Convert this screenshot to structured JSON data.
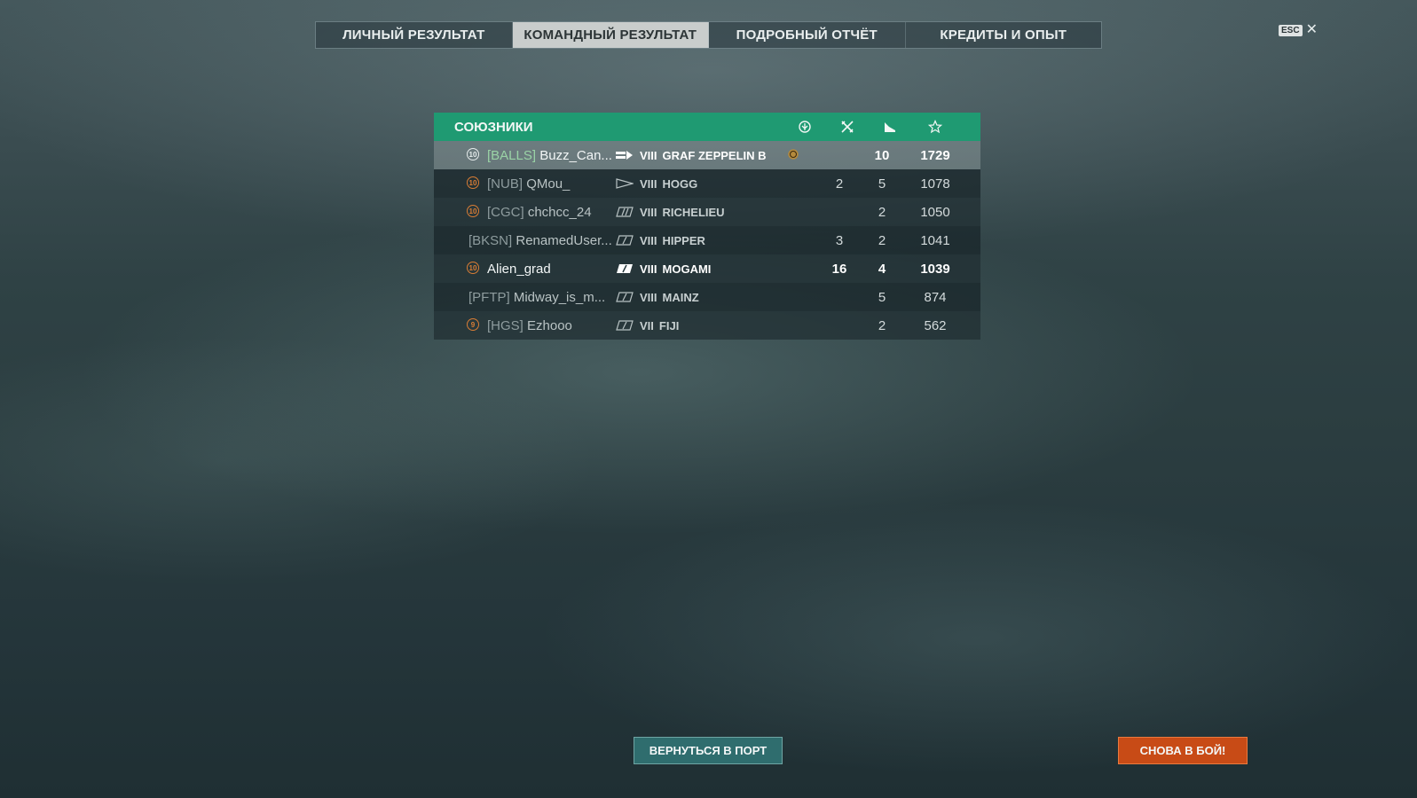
{
  "tabs": [
    {
      "label": "ЛИЧНЫЙ РЕЗУЛЬТАТ",
      "active": false
    },
    {
      "label": "КОМАНДНЫЙ РЕЗУЛЬТАТ",
      "active": true
    },
    {
      "label": "ПОДРОБНЫЙ ОТЧЁТ",
      "active": false
    },
    {
      "label": "КРЕДИТЫ И ОПЫТ",
      "active": false
    }
  ],
  "close": {
    "key": "ESC",
    "icon": "close-icon"
  },
  "team": {
    "title": "СОЮЗНИКИ",
    "columns": [
      {
        "icon": "commander-medal-icon"
      },
      {
        "icon": "crossed-planes-icon"
      },
      {
        "icon": "ship-kill-icon"
      },
      {
        "icon": "star-icon"
      }
    ],
    "rows": [
      {
        "level": "10",
        "clan": "[BALLS]",
        "name": "Buzz_Can...",
        "ship_type": "carrier",
        "tier": "VIII",
        "ship": "GRAF ZEPPELIN B",
        "medal": true,
        "planes": "",
        "kills": "10",
        "exp": "1729",
        "self": true
      },
      {
        "level": "10",
        "clan": "[NUB]",
        "name": "QMou_",
        "ship_type": "destroyer",
        "tier": "VIII",
        "ship": "HOGG",
        "medal": false,
        "planes": "2",
        "kills": "5",
        "exp": "1078"
      },
      {
        "level": "10",
        "clan": "[CGC]",
        "name": "chchcc_24",
        "ship_type": "battleship",
        "tier": "VIII",
        "ship": "RICHELIEU",
        "medal": false,
        "planes": "",
        "kills": "2",
        "exp": "1050"
      },
      {
        "level": "",
        "clan": "[BKSN]",
        "name": "RenamedUser...",
        "ship_type": "cruiser",
        "tier": "VIII",
        "ship": "HIPPER",
        "medal": false,
        "planes": "3",
        "kills": "2",
        "exp": "1041"
      },
      {
        "level": "10",
        "clan": "",
        "name": "Alien_grad",
        "ship_type": "cruiser",
        "tier": "VIII",
        "ship": "MOGAMI",
        "medal": false,
        "planes": "16",
        "kills": "4",
        "exp": "1039",
        "bright": true
      },
      {
        "level": "",
        "clan": "[PFTP]",
        "name": "Midway_is_m...",
        "ship_type": "cruiser",
        "tier": "VIII",
        "ship": "MAINZ",
        "medal": false,
        "planes": "",
        "kills": "5",
        "exp": "874"
      },
      {
        "level": "9",
        "clan": "[HGS]",
        "name": "Ezhooo",
        "ship_type": "cruiser",
        "tier": "VII",
        "ship": "FIJI",
        "medal": false,
        "planes": "",
        "kills": "2",
        "exp": "562"
      }
    ]
  },
  "buttons": {
    "port": "ВЕРНУТЬСЯ В ПОРТ",
    "battle": "СНОВА В БОЙ!"
  },
  "colors": {
    "header": "#1f9a72",
    "battle_button": "#c84b16",
    "port_button": "#2f6d6e",
    "level_badge": "#d97d35"
  }
}
